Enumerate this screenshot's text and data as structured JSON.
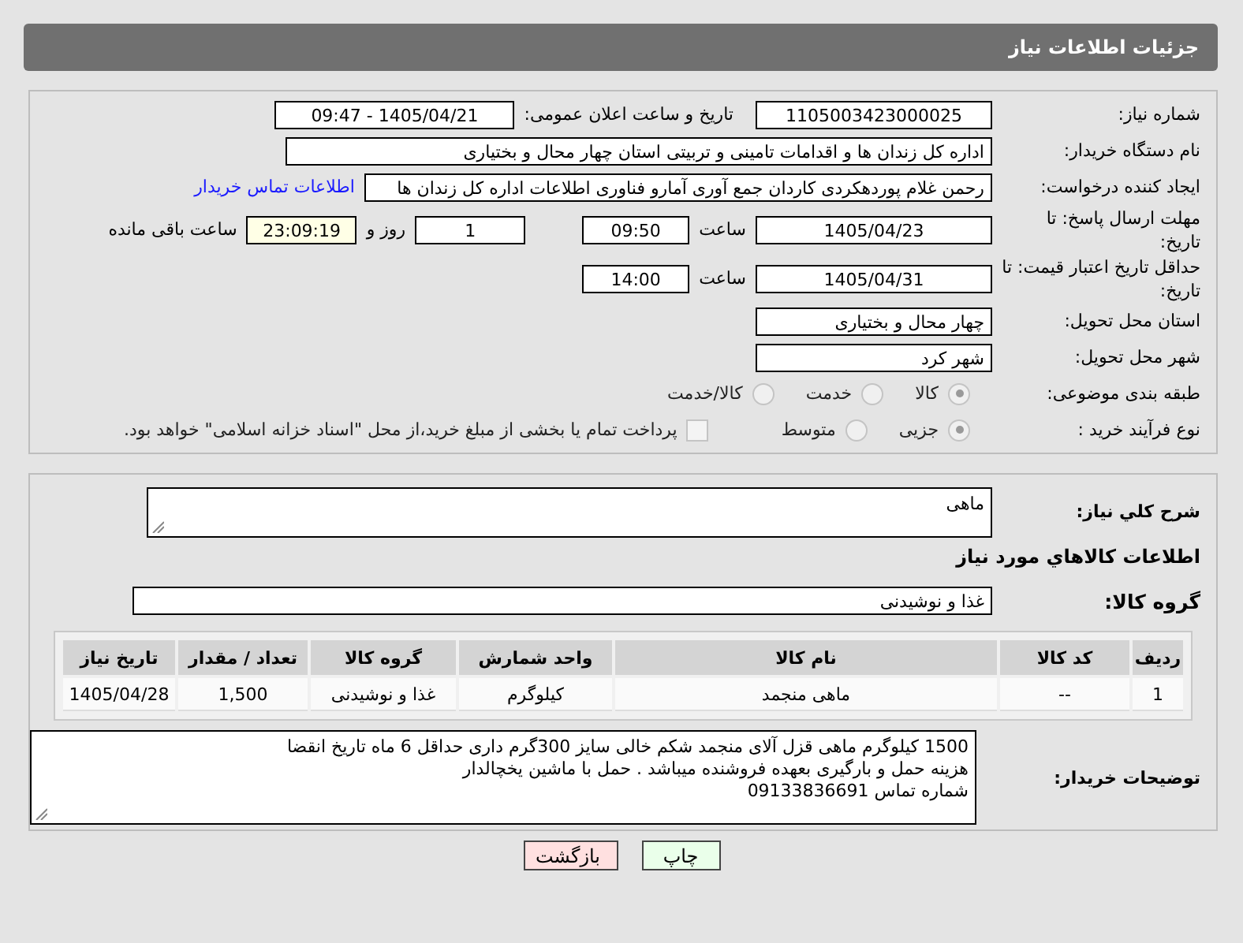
{
  "header": {
    "title": "جزئیات اطلاعات نیاز"
  },
  "need_number": {
    "label": "شماره نیاز:",
    "value": "1105003423000025"
  },
  "announce": {
    "label": "تاریخ و ساعت اعلان عمومی:",
    "value": "1405/04/21 - 09:47"
  },
  "buyer_org": {
    "label": "نام دستگاه خریدار:",
    "value": "اداره کل زندان ها و اقدامات تامینی و تربیتی استان چهار محال و بختیاری"
  },
  "creator": {
    "label": "ایجاد کننده درخواست:",
    "value": "رحمن غلام پوردهکردی کاردان جمع آوری آمارو فناوری اطلاعات اداره کل زندان ها",
    "link": "اطلاعات تماس خریدار"
  },
  "deadline": {
    "label": "مهلت ارسال پاسخ: تا تاریخ:",
    "date": "1405/04/23",
    "time_label": "ساعت",
    "time": "09:50",
    "days": "1",
    "days_label": "روز و",
    "remaining": "23:09:19",
    "remaining_label": "ساعت باقی مانده"
  },
  "validity": {
    "label": "حداقل تاریخ اعتبار قیمت: تا تاریخ:",
    "date": "1405/04/31",
    "time_label": "ساعت",
    "time": "14:00"
  },
  "province": {
    "label": "استان محل تحویل:",
    "value": "چهار محال و بختیاری"
  },
  "city": {
    "label": "شهر محل تحویل:",
    "value": "شهر کرد"
  },
  "category": {
    "label": "طبقه بندی موضوعی:",
    "options": [
      {
        "label": "کالا",
        "selected": true
      },
      {
        "label": "خدمت",
        "selected": false
      },
      {
        "label": "کالا/خدمت",
        "selected": false
      }
    ]
  },
  "process": {
    "label": "نوع فرآیند خرید :",
    "options": [
      {
        "label": "جزیی",
        "selected": true
      },
      {
        "label": "متوسط",
        "selected": false
      }
    ],
    "treasury": {
      "label": "پرداخت تمام یا بخشی از مبلغ خرید،از محل \"اسناد خزانه اسلامی\" خواهد بود.",
      "checked": false
    }
  },
  "summary": {
    "label": "شرح کلي نياز:",
    "value": "ماهی"
  },
  "goods_title": "اطلاعات کالاهاي مورد نياز",
  "goods_group": {
    "label": "گروه کالا:",
    "value": "غذا و نوشیدنی"
  },
  "table": {
    "columns": [
      "ردیف",
      "کد کالا",
      "نام کالا",
      "واحد شمارش",
      "گروه کالا",
      "تعداد / مقدار",
      "تاریخ نیاز"
    ],
    "rows": [
      [
        "1",
        "--",
        "ماهی منجمد",
        "کیلوگرم",
        "غذا و نوشیدنی",
        "1,500",
        "1405/04/28"
      ]
    ]
  },
  "buyer_notes": {
    "label": "توضیحات خریدار:",
    "lines": [
      "1500 کیلوگرم ماهی قزل آلای منجمد شکم خالی سایز 300گرم  داری حداقل 6 ماه تاریخ انقضا",
      "هزینه حمل و بارگیری بعهده فروشنده میباشد . حمل با ماشین یخچالدار",
      "شماره تماس 09133836691"
    ]
  },
  "buttons": [
    {
      "label": "چاپ",
      "kind": "print"
    },
    {
      "label": "بازگشت",
      "kind": "back"
    }
  ]
}
